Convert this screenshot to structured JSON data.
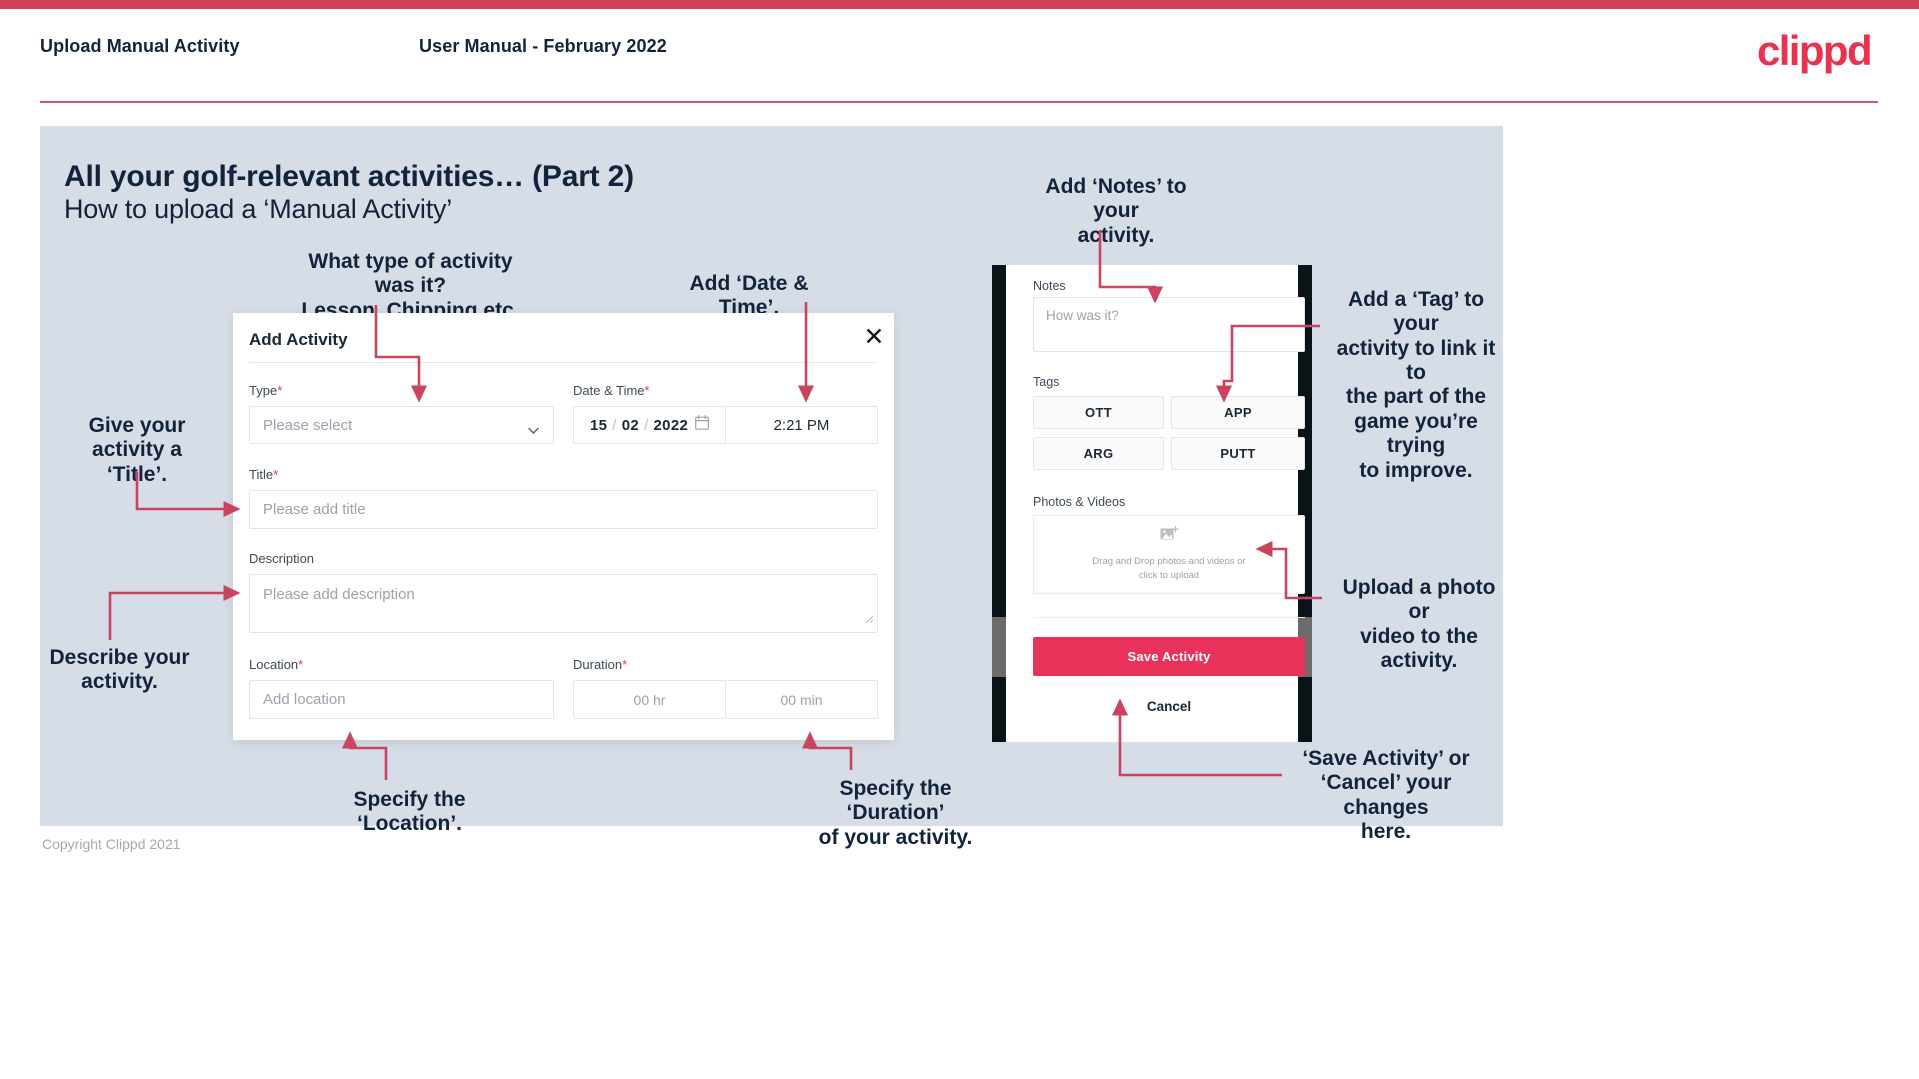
{
  "header": {
    "left_title": "Upload Manual Activity",
    "center_title": "User Manual - February 2022",
    "logo": "clippd"
  },
  "slide": {
    "title": "All your golf-relevant activities… (Part 2)",
    "subtitle": "How to upload a ‘Manual Activity’"
  },
  "annotations": {
    "type": "What type of activity was it?\nLesson, Chipping etc.",
    "type_line1": "What type of activity was it?",
    "type_line2": "Lesson, Chipping etc.",
    "datetime": "Add ‘Date & Time’.",
    "title_hint_l1": "Give your activity a",
    "title_hint_l2": "‘Title’.",
    "describe_l1": "Describe your",
    "describe_l2": "activity.",
    "location": "Specify the ‘Location’.",
    "duration_l1": "Specify the ‘Duration’",
    "duration_l2": "of your activity.",
    "notes_l1": "Add ‘Notes’ to your",
    "notes_l2": "activity.",
    "tag_l1": "Add a ‘Tag’ to your",
    "tag_l2": "activity to link it to",
    "tag_l3": "the part of the",
    "tag_l4": "game you’re trying",
    "tag_l5": "to improve.",
    "upload_l1": "Upload a photo or",
    "upload_l2": "video to the activity.",
    "save_l1": "‘Save Activity’ or",
    "save_l2": "‘Cancel’ your changes",
    "save_l3": "here."
  },
  "dialog": {
    "title": "Add Activity",
    "close_icon": "close-icon",
    "fields": {
      "type": {
        "label": "Type",
        "required": "*",
        "placeholder": "Please select",
        "icon": "chevron-down-icon"
      },
      "datetime": {
        "label": "Date & Time",
        "required": "*",
        "day": "15",
        "month": "02",
        "year": "2022",
        "separator": "/",
        "icon": "calendar-icon",
        "time": "2:21 PM"
      },
      "title": {
        "label": "Title",
        "required": "*",
        "placeholder": "Please add title"
      },
      "description": {
        "label": "Description",
        "required": "",
        "placeholder": "Please add description"
      },
      "location": {
        "label": "Location",
        "required": "*",
        "placeholder": "Add location"
      },
      "duration": {
        "label": "Duration",
        "required": "*",
        "hours": "00 hr",
        "minutes": "00 min"
      }
    }
  },
  "phone": {
    "notes": {
      "label": "Notes",
      "placeholder": "How was it?"
    },
    "tags": {
      "label": "Tags",
      "items": [
        "OTT",
        "APP",
        "ARG",
        "PUTT"
      ]
    },
    "photos": {
      "label": "Photos & Videos",
      "icon": "add-image-icon",
      "drop_line1": "Drag and Drop photos and videos or",
      "drop_line2": "click to upload"
    },
    "save_button": "Save Activity",
    "cancel_button": "Cancel"
  },
  "footer": {
    "copyright": "Copyright Clippd 2021"
  },
  "colors": {
    "brand_pink": "#e8324f",
    "save_pink": "#e8325a",
    "arrow_red": "#c9455f",
    "slide_bg": "#d6dde6",
    "ink": "#13233b"
  }
}
